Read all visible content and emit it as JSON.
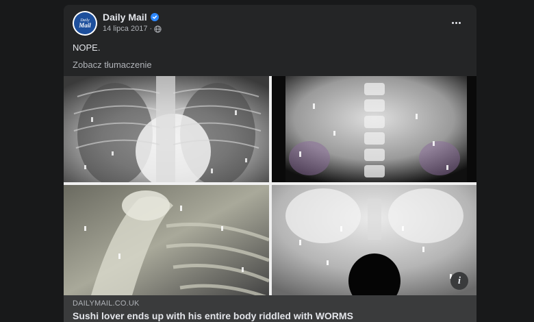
{
  "post": {
    "page_name": "Daily Mail",
    "avatar_line1": "Daily",
    "avatar_line2": "Mail",
    "date": "14 lipca 2017",
    "separator": "·",
    "text": "NOPE.",
    "see_translation": "Zobacz tłumaczenie"
  },
  "images": [
    {
      "name": "chest-xray"
    },
    {
      "name": "abdomen-xray"
    },
    {
      "name": "shoulder-xray"
    },
    {
      "name": "pelvis-xray"
    }
  ],
  "info_button": "i",
  "link": {
    "domain": "DAILYMAIL.CO.UK",
    "title": "Sushi lover ends up with his entire body riddled with WORMS"
  },
  "colors": {
    "background": "#18191a",
    "card": "#242526",
    "link_bar": "#3a3b3c",
    "verified": "#2d88ff",
    "avatar": "#1d4f9c"
  }
}
